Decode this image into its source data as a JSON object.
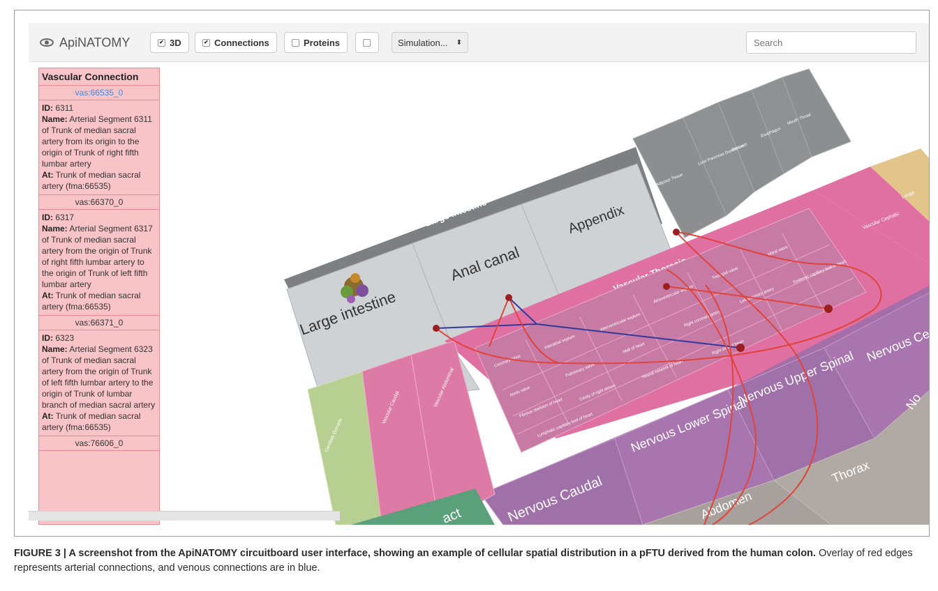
{
  "toolbar": {
    "brand": "ApiNATOMY",
    "btn_3d": "3D",
    "btn_connections": "Connections",
    "btn_proteins": "Proteins",
    "simulation": "Simulation...",
    "search_placeholder": "Search"
  },
  "panel": {
    "title": "Vascular Connection",
    "first_id": "vas:66535_0",
    "entries": [
      {
        "id": "6311",
        "name": "Arterial Segment 6311 of Trunk of median sacral artery from its origin to the origin of Trunk of right fifth lumbar artery",
        "at": "Trunk of median sacral artery (fma:66535)",
        "next": "vas:66370_0"
      },
      {
        "id": "6317",
        "name": "Arterial Segment 6317 of Trunk of median sacral artery from the origin of Trunk of right fifth lumbar artery to the origin of Trunk of left fifth lumbar artery",
        "at": "Trunk of median sacral artery (fma:66535)",
        "next": "vas:66371_0"
      },
      {
        "id": "6323",
        "name": "Arterial Segment 6323 of Trunk of median sacral artery from the origin of Trunk of left fifth lumbar artery to the origin of Trunk of lumbar branch of median sacral artery",
        "at": "Trunk of median sacral artery (fma:66535)",
        "next": "vas:76606_0"
      }
    ],
    "id_label": "ID:",
    "name_label": "Name:",
    "at_label": "At:"
  },
  "board": {
    "large_intestine_header": "Large Intestine",
    "large_intestine": "Large intestine",
    "anal_canal": "Anal canal",
    "appendix": "Appendix",
    "vascular_thoracic": "Vascular Thoracic",
    "vascular_cephalic": "Vascular Cephalic",
    "lungs": "Lungs",
    "genitals_gonads": "Genitals Gonads",
    "vascular_caudal": "Vascular Caudal",
    "vascular_abdominal": "Vascular Abdominal",
    "nervous_caudal": "Nervous Caudal",
    "nervous_lower_spinal": "Nervous Lower Spinal",
    "nervous_upper_spinal": "Nervous Upper Spinal",
    "nervous_cephalic": "Nervous Cephalic",
    "thorax": "Thorax",
    "abdomen": "Abdomen",
    "tract": "act",
    "nervous_partial": "No",
    "heart_cells": [
      "Coronary sinus",
      "Interatrial septum",
      "Interventricular septum",
      "Atrioventricular septum",
      "Tricuspid valve",
      "Mitral valve",
      "Aortic valve",
      "Pulmonary valve",
      "Wall of heart",
      "Cavity of right ventricle",
      "Cavity of left ventricle",
      "Fibrous skeleton of heart",
      "Cavity of right atrium",
      "Cardiac vein",
      "Right coronary artery",
      "Left coronary artery",
      "Lymphatic capillary bed of heart",
      "Neural network of heart",
      "Right side of heart",
      "Left side of heart",
      "Systemic capillary bed of heart"
    ],
    "gray_cells": [
      "Adipose Tissue",
      "Liver Pancreas Duodenum",
      "Stomach",
      "Esophagus",
      "Mouth Throat"
    ]
  },
  "caption": {
    "bold": "FIGURE 3 | A screenshot from the ApiNATOMY circuitboard user interface, showing an example of cellular spatial distribution in a pFTU derived from the human colon.",
    "rest": " Overlay of red edges represents arterial connections, and venous connections are in blue."
  }
}
